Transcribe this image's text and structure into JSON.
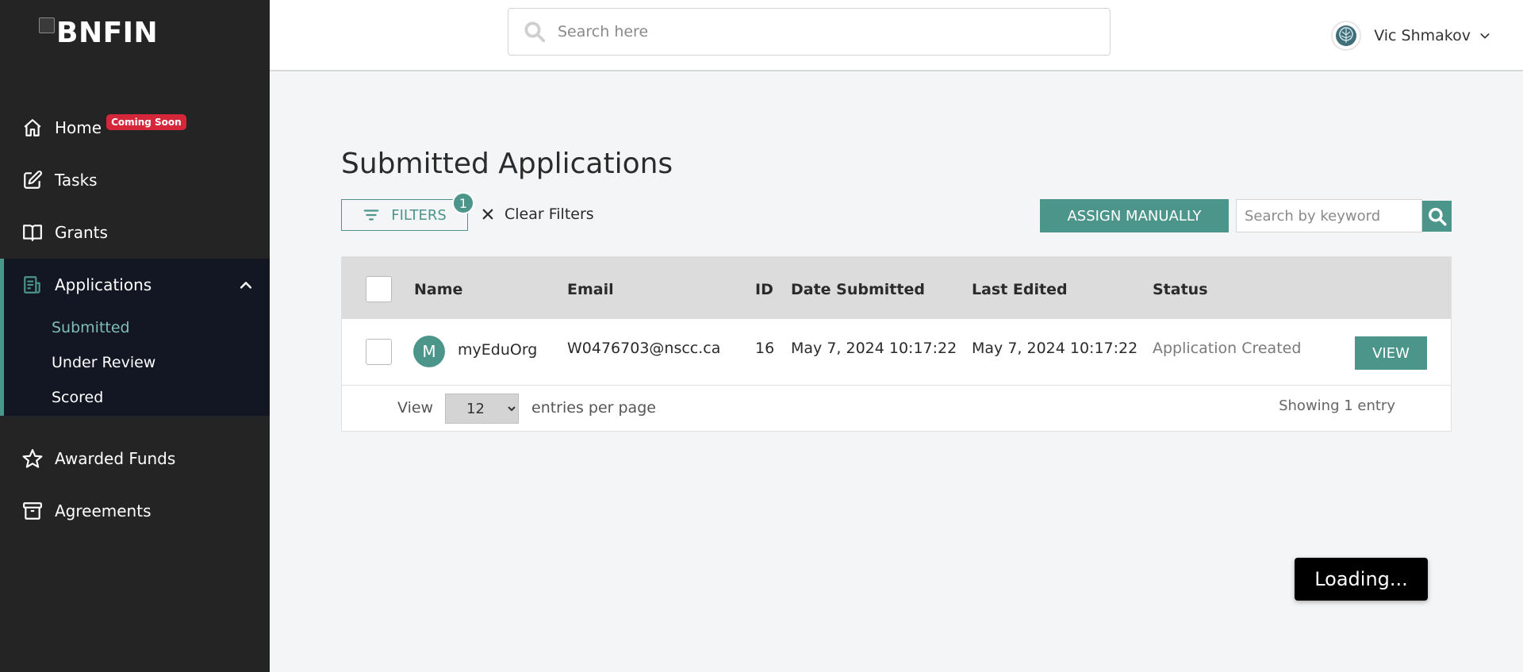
{
  "brand": {
    "logo_text": "BNFIN"
  },
  "sidebar": {
    "items": [
      {
        "label": "Home",
        "badge": "Coming Soon",
        "icon": "home-icon"
      },
      {
        "label": "Tasks",
        "icon": "edit-icon"
      },
      {
        "label": "Grants",
        "icon": "book-icon"
      },
      {
        "label": "Applications",
        "icon": "applications-icon",
        "expanded": true,
        "children": [
          "Submitted",
          "Under Review",
          "Scored"
        ],
        "active_child": "Submitted"
      },
      {
        "label": "Awarded Funds",
        "icon": "star-icon"
      },
      {
        "label": "Agreements",
        "icon": "archive-icon"
      }
    ]
  },
  "header": {
    "search_placeholder": "Search here",
    "user_name": "Vic Shmakov"
  },
  "main": {
    "title": "Submitted Applications",
    "filters_label": "FILTERS",
    "filters_count": "1",
    "clear_filters_label": "Clear Filters",
    "assign_label": "ASSIGN MANUALLY",
    "keyword_placeholder": "Search by keyword",
    "table": {
      "columns": [
        "Name",
        "Email",
        "ID",
        "Date Submitted",
        "Last Edited",
        "Status"
      ],
      "rows": [
        {
          "avatar_letter": "M",
          "name": "myEduOrg",
          "email": "W0476703@nscc.ca",
          "id": "16",
          "date_submitted": "May 7, 2024 10:17:22",
          "last_edited": "May 7, 2024 10:17:22",
          "status": "Application Created",
          "action": "VIEW"
        }
      ]
    },
    "pagination": {
      "view_label": "View",
      "per_page": "12",
      "per_page_options": [
        "12"
      ],
      "per_page_suffix": "entries per page",
      "showing": "Showing 1 entry"
    }
  },
  "loading_label": "Loading...",
  "colors": {
    "accent": "#4b958a",
    "sidebar_bg": "#242424",
    "sidebar_active_bg": "#121723",
    "badge": "#d6263a"
  }
}
